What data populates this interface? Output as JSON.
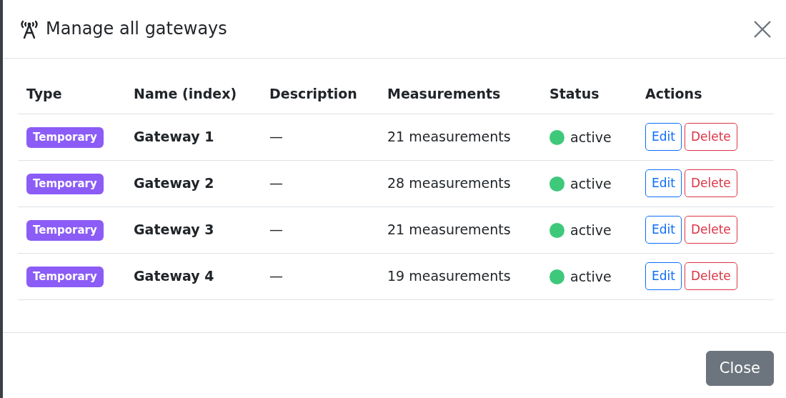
{
  "dialog": {
    "title": "Manage all gateways"
  },
  "table": {
    "columns": [
      "Type",
      "Name (index)",
      "Description",
      "Measurements",
      "Status",
      "Actions"
    ],
    "rows": [
      {
        "type": "Temporary",
        "name": "Gateway 1",
        "description": "—",
        "measurements": "21 measurements",
        "status": "active",
        "color": "#3ec97a",
        "actions": [
          "Edit",
          "Delete"
        ]
      },
      {
        "type": "Temporary",
        "name": "Gateway 2",
        "description": "—",
        "measurements": "28 measurements",
        "status": "active",
        "color": "#3ec97a",
        "actions": [
          "Edit",
          "Delete"
        ]
      },
      {
        "type": "Temporary",
        "name": "Gateway 3",
        "description": "—",
        "measurements": "21 measurements",
        "status": "active",
        "color": "#3ec97a",
        "actions": [
          "Edit",
          "Delete"
        ]
      },
      {
        "type": "Temporary",
        "name": "Gateway 4",
        "description": "—",
        "measurements": "19 measurements",
        "status": "active",
        "color": "#3ec97a",
        "actions": [
          "Edit",
          "Delete"
        ]
      }
    ]
  },
  "footer": {
    "buttons": [
      "Close"
    ]
  }
}
